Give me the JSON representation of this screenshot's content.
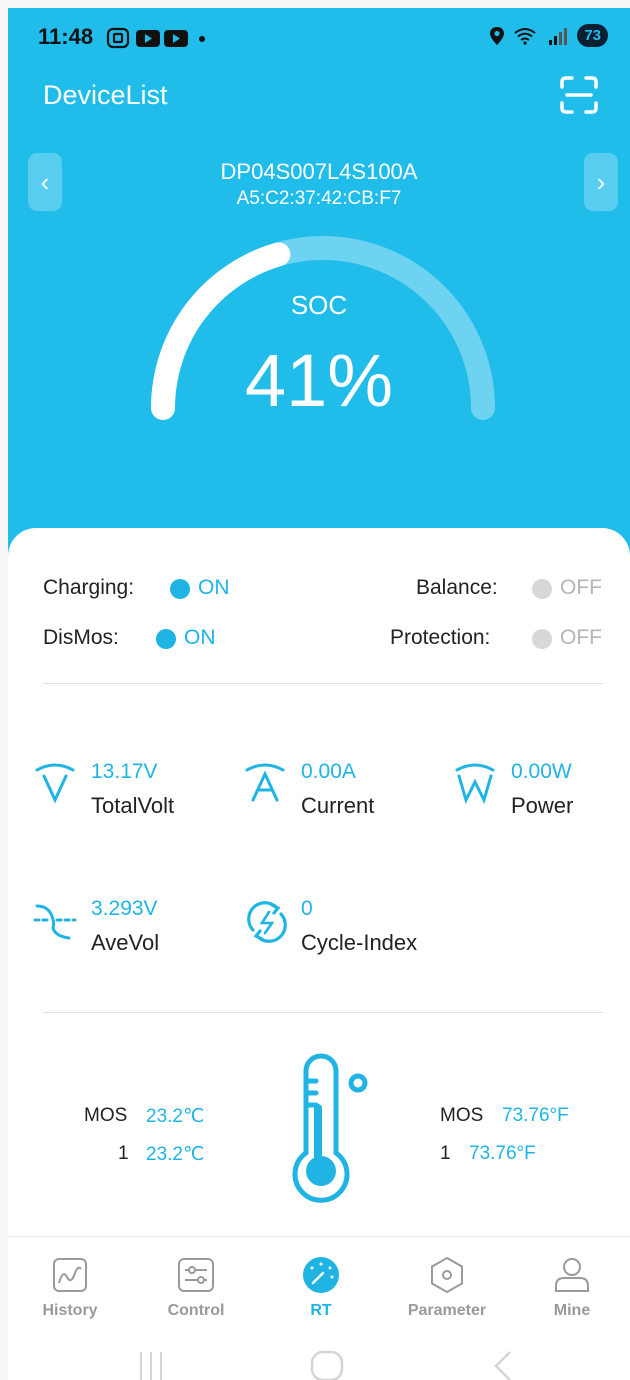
{
  "status_bar": {
    "time": "11:48",
    "battery": "73"
  },
  "header": {
    "title": "DeviceList",
    "device_name": "DP04S007L4S100A",
    "device_mac": "A5:C2:37:42:CB:F7",
    "prev_glyph": "‹",
    "next_glyph": "›"
  },
  "gauge": {
    "label": "SOC",
    "value_text": "41%",
    "fraction": 0.41
  },
  "states": {
    "charging": {
      "label": "Charging:",
      "value": "ON"
    },
    "balance": {
      "label": "Balance:",
      "value": "OFF"
    },
    "dismos": {
      "label": "DisMos:",
      "value": "ON"
    },
    "protection": {
      "label": "Protection:",
      "value": "OFF"
    }
  },
  "metrics": {
    "total_volt": {
      "value": "13.17V",
      "label": "TotalVolt",
      "icon": "voltage-icon"
    },
    "current": {
      "value": "0.00A",
      "label": "Current",
      "icon": "current-icon"
    },
    "power": {
      "value": "0.00W",
      "label": "Power",
      "icon": "power-icon"
    },
    "ave_vol": {
      "value": "3.293V",
      "label": "AveVol",
      "icon": "average-voltage-icon"
    },
    "cycle_index": {
      "value": "0",
      "label": "Cycle-Index",
      "icon": "cycle-icon"
    }
  },
  "temperature": {
    "celsius": [
      {
        "name": "MOS",
        "value": "23.2℃"
      },
      {
        "name": "1",
        "value": "23.2℃"
      }
    ],
    "fahrenheit": [
      {
        "name": "MOS",
        "value": "73.76°F"
      },
      {
        "name": "1",
        "value": "73.76°F"
      }
    ]
  },
  "tabs": [
    {
      "label": "History",
      "icon": "history-icon"
    },
    {
      "label": "Control",
      "icon": "control-icon"
    },
    {
      "label": "RT",
      "icon": "rt-gauge-icon",
      "active": true
    },
    {
      "label": "Parameter",
      "icon": "parameter-icon"
    },
    {
      "label": "Mine",
      "icon": "mine-icon"
    }
  ],
  "colors": {
    "accent": "#1fb4e4",
    "header_bg": "#20bcea",
    "off_gray": "#d8d8d8"
  }
}
